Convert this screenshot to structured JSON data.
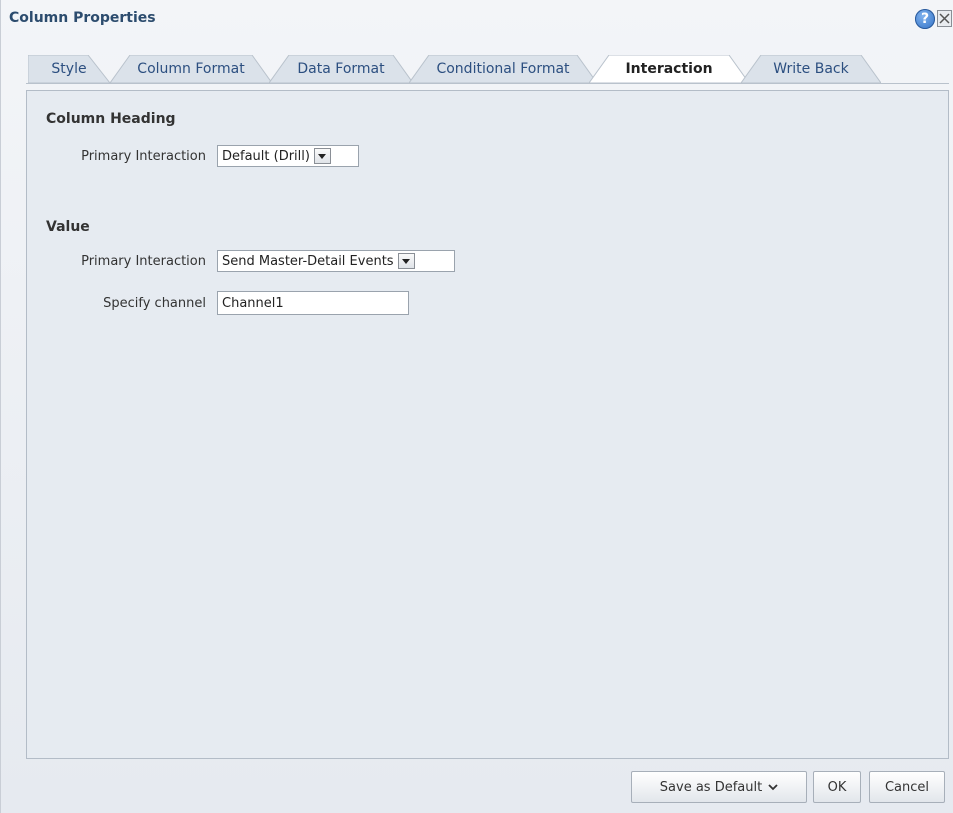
{
  "dialog": {
    "title": "Column Properties",
    "help_glyph": "?"
  },
  "tabs": [
    {
      "label": "Style",
      "active": false
    },
    {
      "label": "Column Format",
      "active": false
    },
    {
      "label": "Data Format",
      "active": false
    },
    {
      "label": "Conditional Format",
      "active": false
    },
    {
      "label": "Interaction",
      "active": true
    },
    {
      "label": "Write Back",
      "active": false
    }
  ],
  "column_heading": {
    "heading": "Column Heading",
    "primary_label": "Primary Interaction",
    "primary_value": "Default (Drill)"
  },
  "value": {
    "heading": "Value",
    "primary_label": "Primary Interaction",
    "primary_value": "Send Master-Detail Events",
    "channel_label": "Specify channel",
    "channel_value": "Channel1"
  },
  "footer": {
    "save_default": "Save as Default",
    "ok": "OK",
    "cancel": "Cancel"
  },
  "icons": {
    "help": "help-icon",
    "close": "close-icon",
    "dropdown": "chevron-down-icon"
  },
  "colors": {
    "title": "#2c4c6e",
    "tab_text": "#2c4f80",
    "panel_bg": "#e6ebf1"
  }
}
